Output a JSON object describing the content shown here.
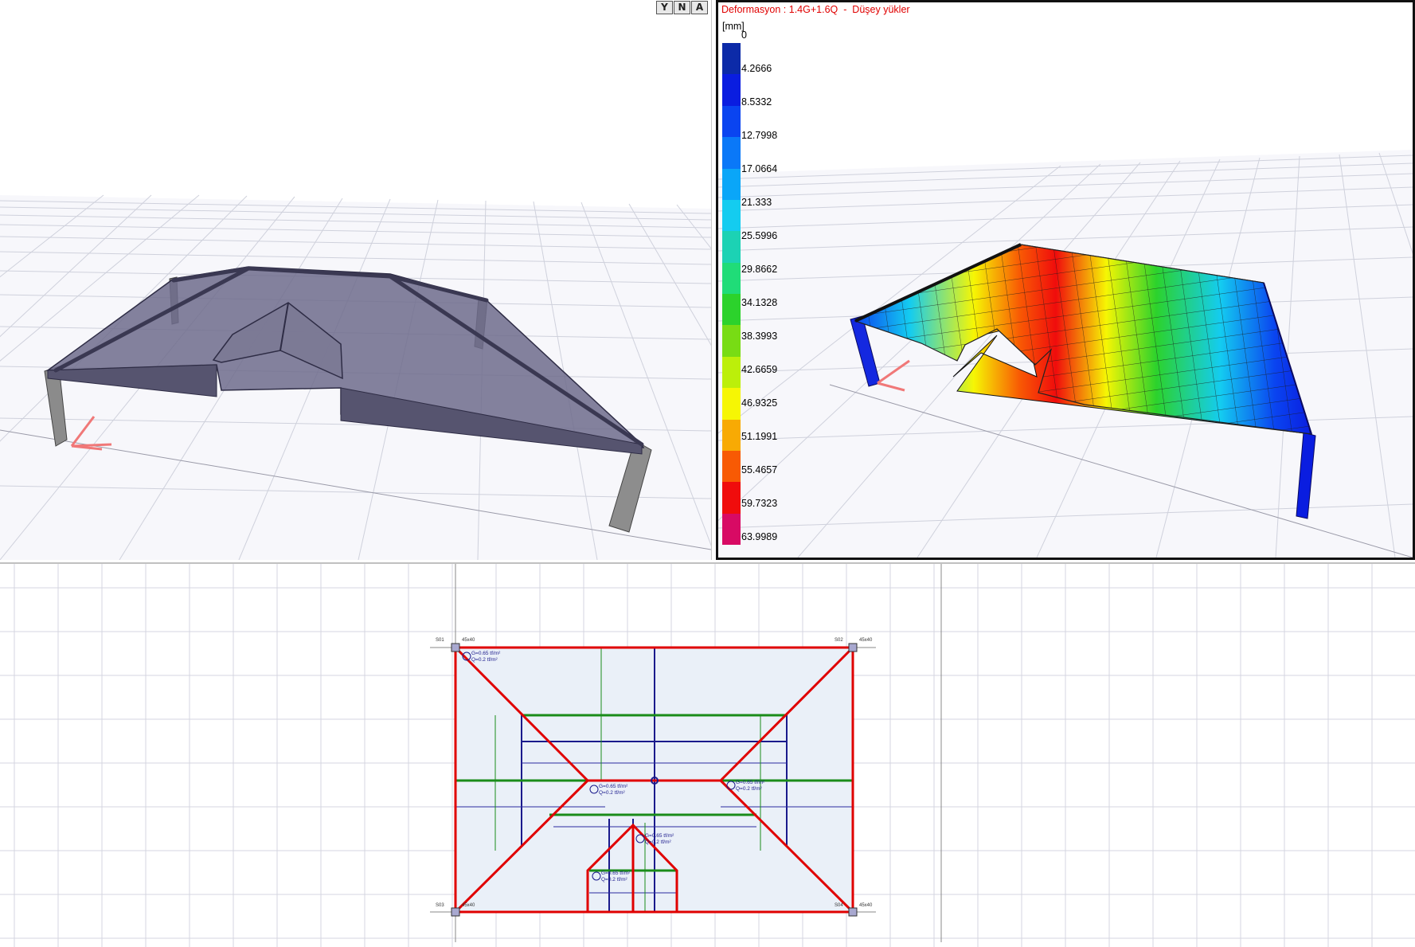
{
  "view_buttons": {
    "btn1": "Y",
    "btn2": "N",
    "btn3": "A"
  },
  "deformation": {
    "title": "Deformasyon : 1.4G+1.6Q  -  Düşey yükler",
    "unit": "[mm]",
    "legend": [
      {
        "label": "0",
        "color": "#0c2aa8"
      },
      {
        "label": "4.2666",
        "color": "#0a1de0"
      },
      {
        "label": "8.5332",
        "color": "#0a44f0"
      },
      {
        "label": "12.7998",
        "color": "#0a78f8"
      },
      {
        "label": "17.0664",
        "color": "#0aa6f8"
      },
      {
        "label": "21.333",
        "color": "#14ccf0"
      },
      {
        "label": "25.5996",
        "color": "#1cd2b4"
      },
      {
        "label": "29.8662",
        "color": "#20dc78"
      },
      {
        "label": "34.1328",
        "color": "#2cd22c"
      },
      {
        "label": "38.3993",
        "color": "#78dc14"
      },
      {
        "label": "42.6659",
        "color": "#bcef0a"
      },
      {
        "label": "46.9325",
        "color": "#f6f604"
      },
      {
        "label": "51.1991",
        "color": "#f8aa04"
      },
      {
        "label": "55.4657",
        "color": "#f85a04"
      },
      {
        "label": "59.7323",
        "color": "#f00c0c"
      },
      {
        "label": "63.9989",
        "color": "#d80a64"
      }
    ]
  },
  "plan": {
    "load_labels": [
      {
        "g": "G=0.65 tf/m²",
        "q": "Q=0.2 tf/m²"
      },
      {
        "g": "G=0.65 tf/m²",
        "q": "Q=0.2 tf/m²"
      },
      {
        "g": "G=0.65 tf/m²",
        "q": "Q=0.2 tf/m²"
      },
      {
        "g": "G=0.65 tf/m²",
        "q": "Q=0.2 tf/m²"
      },
      {
        "g": "G=0.65 tf/m²",
        "q": "Q=0.2 tf/m²"
      }
    ],
    "column_labels": [
      "S01",
      "S02",
      "S03",
      "S04"
    ],
    "column_sizes": [
      "45x40",
      "45x40",
      "45x40",
      "45x40"
    ]
  }
}
